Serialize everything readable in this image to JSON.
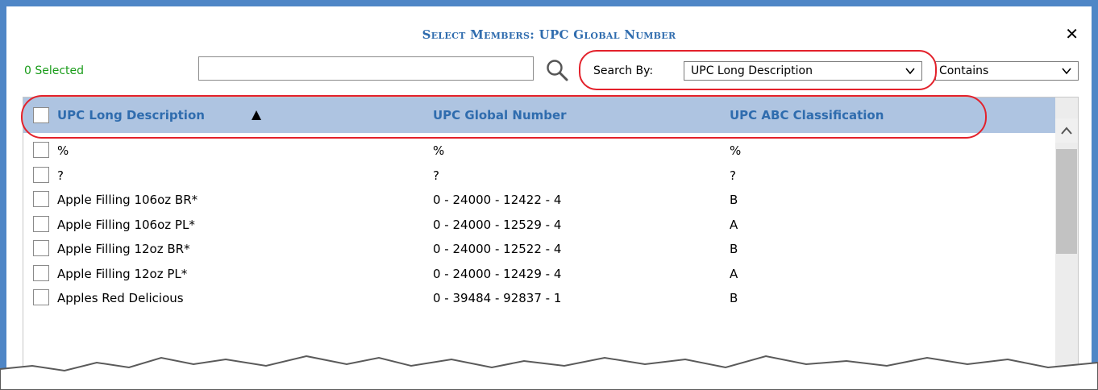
{
  "dialog": {
    "title": "Select Members: UPC Global Number",
    "close_label": "✕"
  },
  "toolbar": {
    "selected_count": "0 Selected",
    "search_value": "",
    "search_by_label": "Search By:",
    "search_by_value": "UPC Long Description",
    "match_value": "Contains"
  },
  "table": {
    "columns": [
      "UPC Long Description",
      "UPC Global Number",
      "UPC ABC Classification"
    ],
    "sort_indicator": "▲",
    "rows": [
      {
        "desc": "%",
        "number": "%",
        "abc": "%"
      },
      {
        "desc": "?",
        "number": "?",
        "abc": "?"
      },
      {
        "desc": "Apple Filling 106oz BR*",
        "number": "0 - 24000 - 12422 - 4",
        "abc": "B"
      },
      {
        "desc": "Apple Filling 106oz PL*",
        "number": "0 - 24000 - 12529 - 4",
        "abc": "A"
      },
      {
        "desc": "Apple Filling 12oz BR*",
        "number": "0 - 24000 - 12522 - 4",
        "abc": "B"
      },
      {
        "desc": "Apple Filling 12oz PL*",
        "number": "0 - 24000 - 12429 - 4",
        "abc": "A"
      },
      {
        "desc": "Apples Red Delicious",
        "number": "0 - 39484 - 92837 - 1",
        "abc": "B"
      }
    ]
  },
  "colors": {
    "frame": "#4f86c6",
    "header_bg": "#aec4e1",
    "header_text": "#2f6cae",
    "selected_text": "#1a9c1a",
    "highlight": "#e3212b"
  }
}
